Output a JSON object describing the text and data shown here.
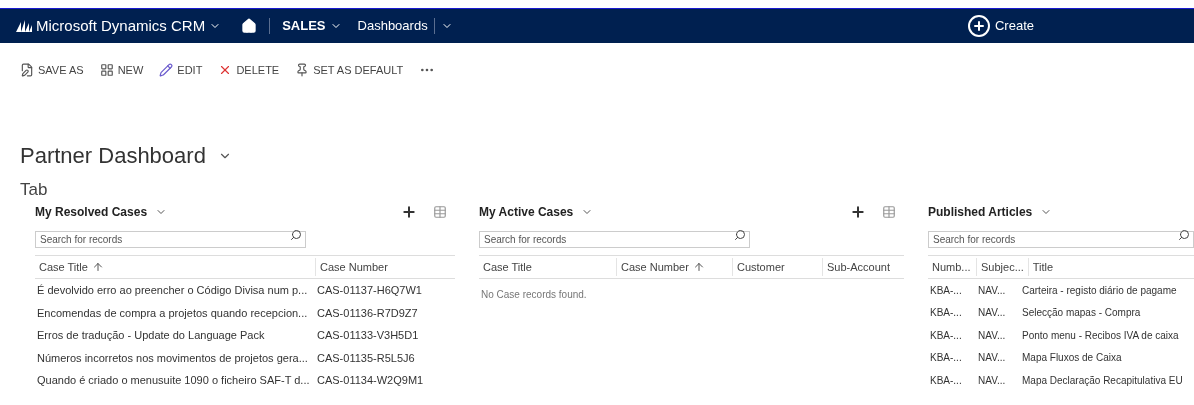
{
  "nav": {
    "app_title": "Microsoft Dynamics CRM",
    "area": "SALES",
    "section": "Dashboards",
    "create": "Create"
  },
  "toolbar": [
    "SAVE AS",
    "NEW",
    "EDIT",
    "DELETE",
    "SET AS DEFAULT"
  ],
  "dashboard_title": "Partner Dashboard",
  "tab_label": "Tab",
  "panels": [
    {
      "title": "My Resolved Cases",
      "search_placeholder": "Search for records",
      "has_actions": true,
      "columns": [
        {
          "label": "Case Title",
          "sorted": true
        },
        {
          "label": "Case Number",
          "sorted": false
        }
      ],
      "rows": [
        [
          "É devolvido erro ao preencher o Código Divisa num p...",
          "CAS-01137-H6Q7W1"
        ],
        [
          "Encomendas de compra a projetos quando recepcion...",
          "CAS-01136-R7D9Z7"
        ],
        [
          "Erros de tradução - Update do Language Pack",
          "CAS-01133-V3H5D1"
        ],
        [
          "Números incorretos nos movimentos de projetos gera...",
          "CAS-01135-R5L5J6"
        ],
        [
          "Quando é criado o menusuite 1090 o ficheiro SAF-T d...",
          "CAS-01134-W2Q9M1"
        ]
      ]
    },
    {
      "title": "My Active Cases",
      "search_placeholder": "Search for records",
      "has_actions": true,
      "columns": [
        {
          "label": "Case Title",
          "sorted": false
        },
        {
          "label": "Case Number",
          "sorted": true
        },
        {
          "label": "Customer",
          "sorted": false
        },
        {
          "label": "Sub-Account",
          "sorted": false
        }
      ],
      "empty_message": "No Case records found."
    },
    {
      "title": "Published Articles",
      "search_placeholder": "Search for records",
      "has_actions": false,
      "columns": [
        {
          "label": "Numb...",
          "sorted": false
        },
        {
          "label": "Subjec...",
          "sorted": false
        },
        {
          "label": "Title",
          "sorted": false
        }
      ],
      "rows": [
        [
          "KBA-...",
          "NAV...",
          "Carteira - registo diário de pagame"
        ],
        [
          "KBA-...",
          "NAV...",
          "Selecção mapas - Compra"
        ],
        [
          "KBA-...",
          "NAV...",
          "Ponto menu - Recibos IVA de caixa"
        ],
        [
          "KBA-...",
          "NAV...",
          "Mapa Fluxos de Caixa"
        ],
        [
          "KBA-...",
          "NAV...",
          "Mapa Declaração Recapitulativa EU"
        ]
      ]
    }
  ]
}
